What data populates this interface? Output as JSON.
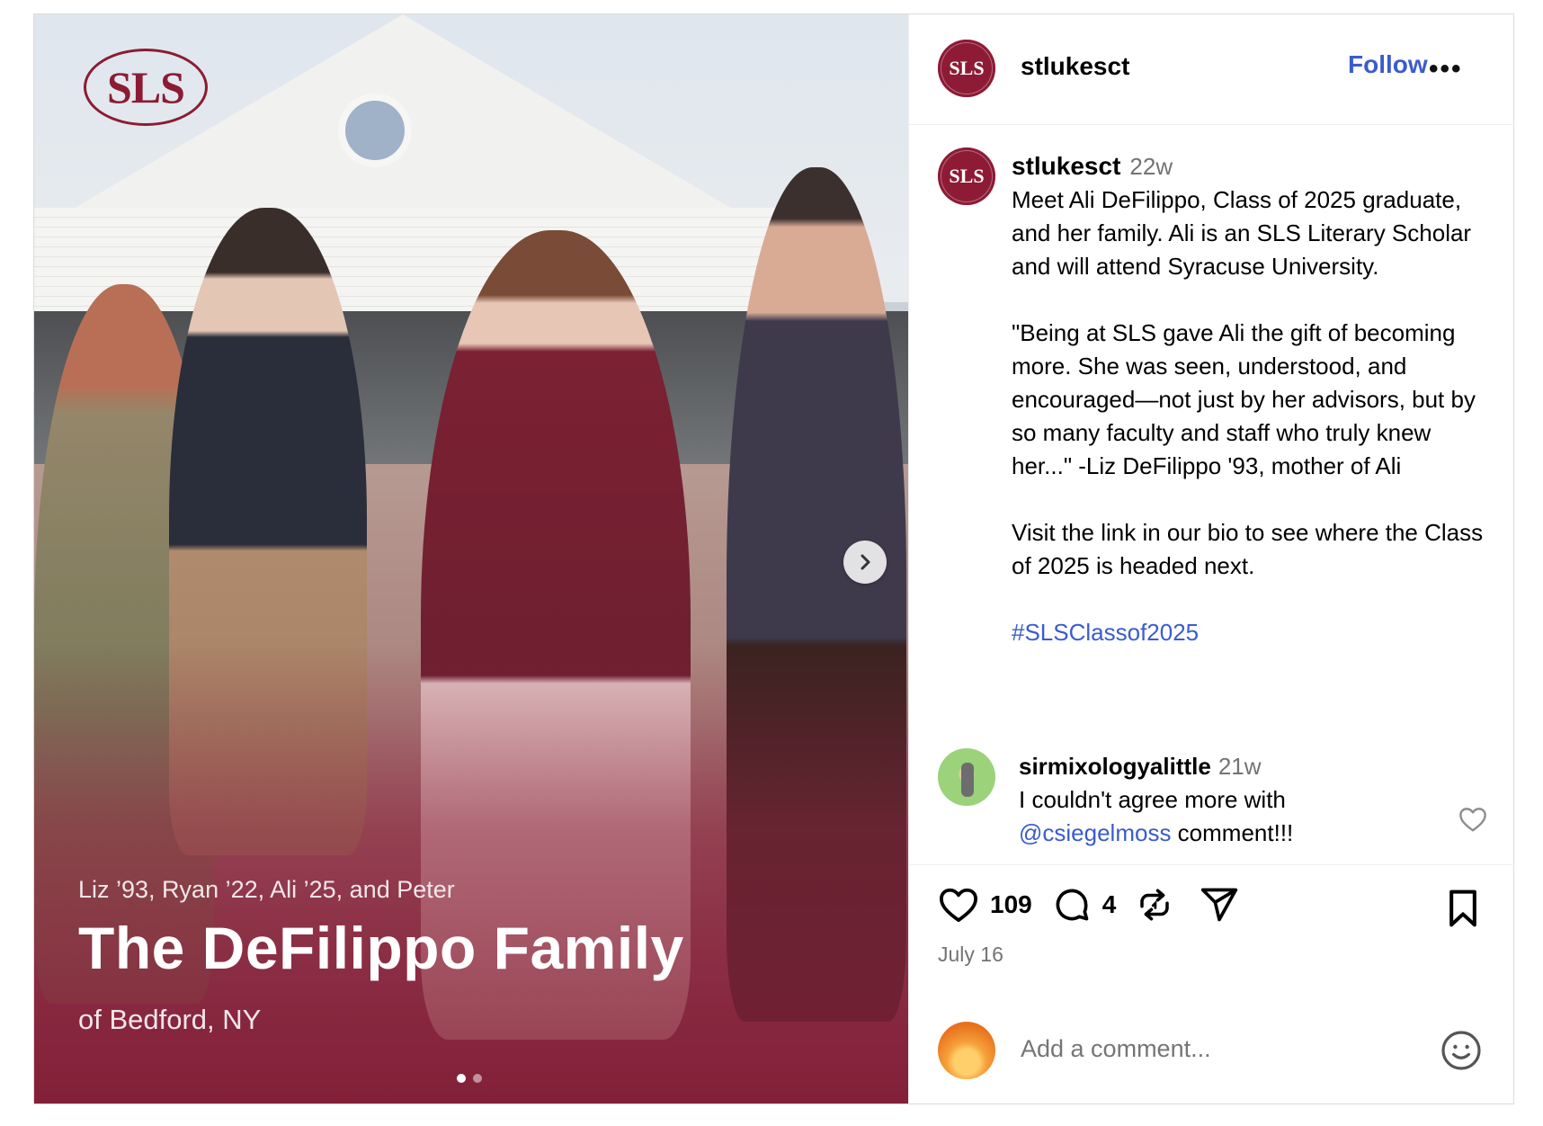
{
  "photo": {
    "logo_text": "SLS",
    "caption_small": "Liz ’93, Ryan ’22, Ali ’25, and Peter",
    "caption_big": "The DeFilippo Family",
    "caption_location": "of Bedford, NY",
    "slide_count": 2,
    "active_slide": 1
  },
  "header": {
    "avatar_text": "SLS",
    "username": "stlukesct",
    "follow_label": "Follow",
    "more_label": "•••"
  },
  "caption": {
    "avatar_text": "SLS",
    "username": "stlukesct",
    "time": "22w",
    "paragraph1": "Meet Ali DeFilippo, Class of 2025 graduate, and her family. Ali is an SLS Literary Scholar and will attend Syracuse University.",
    "paragraph2": "\"Being at SLS gave Ali the gift of becoming more. She was seen, understood, and encouraged—not just by her advisors, but by so many faculty and staff who truly knew her...\" -Liz DeFilippo '93, mother of Ali",
    "paragraph3": "Visit the link in our bio to see where the Class of 2025 is headed next.",
    "hashtag": "#SLSClassof2025"
  },
  "comment": {
    "username": "sirmixologyalittle",
    "time": "21w",
    "text_before": "I couldn't agree more with",
    "mention": "@csiegelmoss",
    "text_after": " comment!!!"
  },
  "actions": {
    "likes": "109",
    "comments": "4",
    "date": "July 16"
  },
  "add_comment": {
    "placeholder": "Add a comment..."
  },
  "colors": {
    "brand_maroon": "#8e1b36",
    "link_blue": "#3b5ccc",
    "muted_gray": "#737373"
  }
}
